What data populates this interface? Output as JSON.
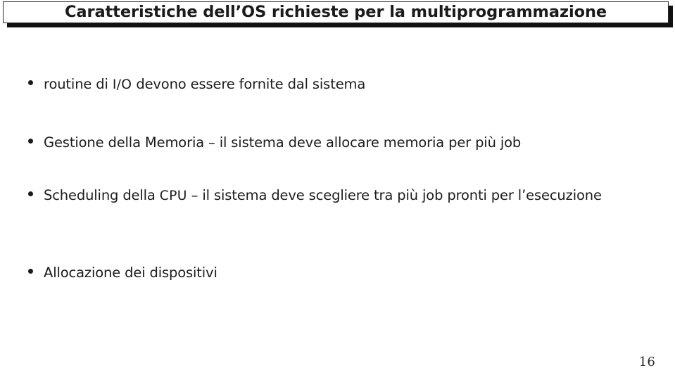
{
  "slide": {
    "title": "Caratteristiche dell’OS richieste per la multiprogrammazione",
    "page_number": "16",
    "accent_color": "#111111",
    "text_color": "#1c1c1c",
    "background_color": "#ffffff",
    "bullets": [
      {
        "marker": "bullet-dot",
        "text": "routine di I/O devono essere fornite dal sistema",
        "pre": "routine di ",
        "acronym": "I/O",
        "post": " devono essere fornite dal sistema",
        "justified": false
      },
      {
        "marker": "bullet-dot",
        "text": "Gestione della Memoria – il sistema deve allocare memoria per più job",
        "pre": "Gestione della Memoria – il sistema deve allocare memoria per più job",
        "acronym": "",
        "post": "",
        "justified": true
      },
      {
        "marker": "bullet-dot",
        "text": "Scheduling della CPU – il sistema deve scegliere tra più job pronti per l’esecuzione",
        "pre": "Scheduling della ",
        "acronym": "CPU",
        "post": " – il sistema deve scegliere tra più job pronti per l’esecuzione",
        "justified": true
      },
      {
        "marker": "bullet-dot",
        "text": "Allocazione dei dispositivi",
        "pre": "Allocazione dei dispositivi",
        "acronym": "",
        "post": "",
        "justified": false
      }
    ]
  }
}
